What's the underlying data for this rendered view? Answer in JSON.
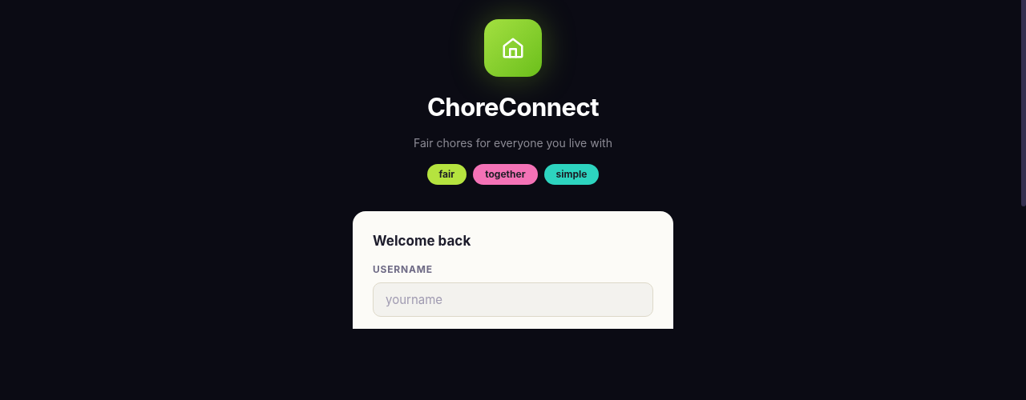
{
  "app": {
    "name": "ChoreConnect",
    "tagline": "Fair chores for everyone you live with"
  },
  "tags": [
    {
      "label": "fair",
      "color": "#b5e33f"
    },
    {
      "label": "together",
      "color": "#f472b6"
    },
    {
      "label": "simple",
      "color": "#2dd4bf"
    }
  ],
  "card": {
    "title": "Welcome back",
    "field": {
      "label": "USERNAME",
      "placeholder": "yourname"
    }
  }
}
